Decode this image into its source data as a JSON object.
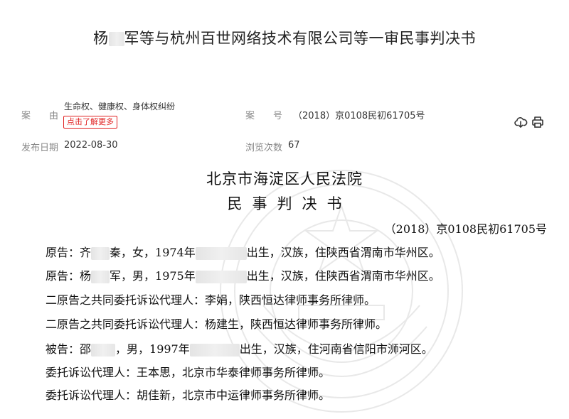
{
  "header": {
    "title_pre": "杨",
    "title_post": "军等与杭州百世网络技术有限公司等一审民事判决书"
  },
  "meta": {
    "cause_label": "案　　由",
    "cause_value": "生命权、健康权、身体权纠纷",
    "more_button": "点击了解更多",
    "case_no_label": "案　　号",
    "case_no_value": "（2018）京0108民初61705号",
    "publish_date_label": "发布日期",
    "publish_date_value": "2022-08-30",
    "views_label": "浏览次数",
    "views_value": "67"
  },
  "icons": {
    "download": "cloud-download-icon",
    "print": "printer-icon"
  },
  "document": {
    "court": "北京市海淀区人民法院",
    "doc_type": "民事判决书",
    "case_no": "（2018）京0108民初61705号",
    "lines": [
      {
        "a": "原告：齐",
        "b": "秦，女，1974年",
        "c": "出生，汉族，住陕西省渭南市华州区。"
      },
      {
        "a": "原告：杨",
        "b": "军，男，1975年",
        "c": "出生，汉族，住陕西省渭南市华州区。"
      },
      {
        "a": "二原告之共同委托诉讼代理人：李娟，陕西恒达律师事务所律师。"
      },
      {
        "a": "二原告之共同委托诉讼代理人：杨建生，陕西恒达律师事务所律师。"
      },
      {
        "a": "被告：邵",
        "b": "，男，1997年",
        "c": "出生，汉族，住河南省信阳市浉河区。"
      },
      {
        "a": "委托诉讼代理人：王本思，北京市华泰律师事务所律师。"
      },
      {
        "a": "委托诉讼代理人：胡佳新，北京市中运律师事务所律师。"
      }
    ]
  },
  "colors": {
    "accent_red": "#e02020",
    "meta_label": "#888888"
  }
}
